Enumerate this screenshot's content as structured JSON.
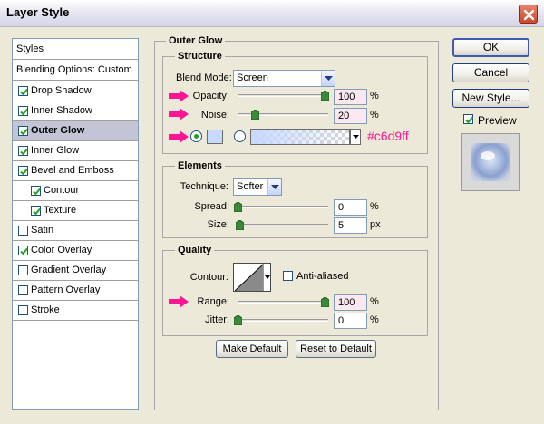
{
  "window": {
    "title": "Layer Style"
  },
  "styles_list": {
    "header": "Styles",
    "blending": "Blending Options: Custom",
    "items": [
      {
        "label": "Drop Shadow",
        "checked": true,
        "selected": false,
        "indent": false
      },
      {
        "label": "Inner Shadow",
        "checked": true,
        "selected": false,
        "indent": false
      },
      {
        "label": "Outer Glow",
        "checked": true,
        "selected": true,
        "indent": false
      },
      {
        "label": "Inner Glow",
        "checked": true,
        "selected": false,
        "indent": false
      },
      {
        "label": "Bevel and Emboss",
        "checked": true,
        "selected": false,
        "indent": false
      },
      {
        "label": "Contour",
        "checked": true,
        "selected": false,
        "indent": true
      },
      {
        "label": "Texture",
        "checked": true,
        "selected": false,
        "indent": true
      },
      {
        "label": "Satin",
        "checked": false,
        "selected": false,
        "indent": false
      },
      {
        "label": "Color Overlay",
        "checked": true,
        "selected": false,
        "indent": false
      },
      {
        "label": "Gradient Overlay",
        "checked": false,
        "selected": false,
        "indent": false
      },
      {
        "label": "Pattern Overlay",
        "checked": false,
        "selected": false,
        "indent": false
      },
      {
        "label": "Stroke",
        "checked": false,
        "selected": false,
        "indent": false
      }
    ]
  },
  "panel": {
    "title": "Outer Glow",
    "structure": {
      "title": "Structure",
      "blend_mode_label": "Blend Mode:",
      "blend_mode_value": "Screen",
      "opacity_label": "Opacity:",
      "opacity_value": "100",
      "opacity_fraction": 1.0,
      "noise_label": "Noise:",
      "noise_value": "20",
      "noise_fraction": 0.2,
      "percent": "%",
      "glow_color": "#c6d9ff",
      "color_annotation": "#c6d9ff"
    },
    "elements": {
      "title": "Elements",
      "technique_label": "Technique:",
      "technique_value": "Softer",
      "spread_label": "Spread:",
      "spread_value": "0",
      "spread_fraction": 0.0,
      "size_label": "Size:",
      "size_value": "5",
      "size_fraction": 0.02,
      "size_unit": "px",
      "percent": "%"
    },
    "quality": {
      "title": "Quality",
      "contour_label": "Contour:",
      "anti_aliased_label": "Anti-aliased",
      "anti_aliased": false,
      "range_label": "Range:",
      "range_value": "100",
      "range_fraction": 1.0,
      "jitter_label": "Jitter:",
      "jitter_value": "0",
      "jitter_fraction": 0.0,
      "percent": "%"
    },
    "make_default": "Make Default",
    "reset_default": "Reset to Default"
  },
  "actions": {
    "ok": "OK",
    "cancel": "Cancel",
    "new_style": "New Style...",
    "preview_label": "Preview",
    "preview_checked": true
  },
  "colors": {
    "accent_arrow": "#ff1493",
    "selection": "#c1c5d6"
  }
}
